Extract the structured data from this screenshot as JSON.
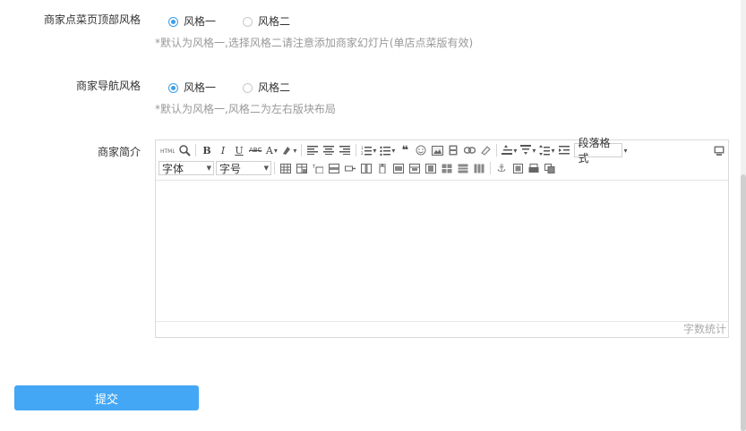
{
  "fields": {
    "top_style": {
      "label": "商家点菜页顶部风格",
      "options": [
        "风格一",
        "风格二"
      ],
      "selected_index": 0,
      "hint": "*默认为风格一,选择风格二请注意添加商家幻灯片(单店点菜版有效)"
    },
    "nav_style": {
      "label": "商家导航风格",
      "options": [
        "风格一",
        "风格二"
      ],
      "selected_index": 0,
      "hint": "*默认为风格一,风格二为左右版块布局"
    },
    "intro": {
      "label": "商家简介",
      "toolbar": {
        "font_label": "字体",
        "size_label": "字号",
        "paragraph_label": "段落格式"
      },
      "word_count_label": "字数统计",
      "value": ""
    }
  },
  "submit_label": "提交",
  "colors": {
    "accent": "#3d9ee8",
    "button": "#43a7f5",
    "hint": "#999999"
  }
}
